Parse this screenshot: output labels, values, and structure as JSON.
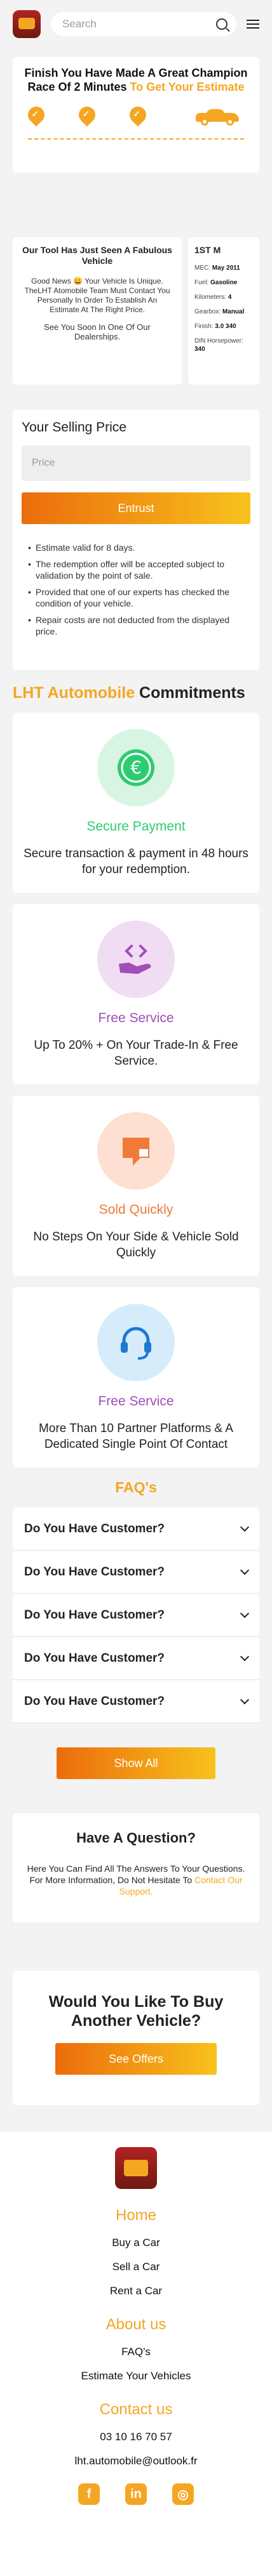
{
  "header": {
    "search_placeholder": "Search"
  },
  "estimate": {
    "title_main": "Finish You Have Made A Great Champion Race Of 2 Minutes ",
    "title_highlight": "To Get Your Estimate"
  },
  "tool": {
    "title": "Our Tool Has Just Seen A Fabulous Vehicle",
    "message": "Good News 😀 Your Vehicle Is Unique. TheLHT Atomobile Team Must Contact You Personally In Order To Establish An Estimate At The Right Price.",
    "see_you": "See You Soon In One Of Our Dealerships.",
    "vehicle_name": "1ST M",
    "specs": [
      {
        "label": "MEC: ",
        "value": "May 2011"
      },
      {
        "label": "Fuel: ",
        "value": "Gasoline"
      },
      {
        "label": "Kilometers: ",
        "value": "4"
      },
      {
        "label": "Gearbox: ",
        "value": "Manual"
      },
      {
        "label": "Finish: ",
        "value": "3.0 340"
      },
      {
        "label": "DIN Horsepower: ",
        "value": "340"
      }
    ]
  },
  "selling": {
    "title": "Your Selling Price",
    "price_placeholder": "Price",
    "button": "Entrust",
    "notes": [
      "Estimate valid for 8 days.",
      "The redemption offer will be accepted subject to validation by the point of sale.",
      "Provided that one of our experts has checked the condition of your vehicle.",
      "Repair costs are not deducted from the displayed price."
    ]
  },
  "commitments": {
    "title_brand": "LHT Automobile",
    "title_rest": " Commitments",
    "items": [
      {
        "title": "Secure Payment",
        "text": "Secure transaction & payment in 48 hours for your redemption.",
        "color": "#2ecc71",
        "bg": "#d8f5e4",
        "icon": "euro-icon"
      },
      {
        "title": "Free Service",
        "text": "Up To 20% + On Your Trade-In & Free Service.",
        "color": "#a24db8",
        "bg": "#f0ddf4",
        "icon": "hand-code-icon"
      },
      {
        "title": "Sold Quickly",
        "text": "No Steps On Your Side & Vehicle Sold Quickly",
        "color": "#f07a3a",
        "bg": "#fde0d2",
        "icon": "message-icon"
      },
      {
        "title": "Free Service",
        "text": "More Than 10 Partner Platforms & A Dedicated Single Point Of Contact",
        "color": "#a24db8",
        "bg": "#d6ecfa",
        "icon": "headset-icon"
      }
    ]
  },
  "faq": {
    "title": "FAQ's",
    "items": [
      "Do You Have Customer?",
      "Do You Have Customer?",
      "Do You Have Customer?",
      "Do You Have Customer?",
      "Do You Have Customer?"
    ],
    "show_all": "Show All"
  },
  "question": {
    "title": "Have A Question?",
    "text": "Here You Can Find All The Answers To Your Questions. For More Information, Do Not Hesitate To ",
    "link": "Contact Our Support."
  },
  "buy": {
    "title": "Would You Like To Buy Another Vehicle?",
    "button": "See Offers"
  },
  "footer": {
    "home_title": "Home",
    "home_links": [
      "Buy a Car",
      "Sell a Car",
      "Rent a Car"
    ],
    "about_title": "About us",
    "about_links": [
      "FAQ's",
      "Estimate Your Vehicles"
    ],
    "contact_title": "Contact us",
    "phone": "03 10 16 70 57",
    "email": "lht.automobile@outlook.fr",
    "socials": [
      {
        "name": "facebook-icon",
        "glyph": "f"
      },
      {
        "name": "linkedin-icon",
        "glyph": "in"
      },
      {
        "name": "instagram-icon",
        "glyph": "◎"
      }
    ]
  },
  "colors": {
    "accent": "#f4a623",
    "gradient_start": "#ec6c0c",
    "gradient_end": "#f7c21c"
  }
}
